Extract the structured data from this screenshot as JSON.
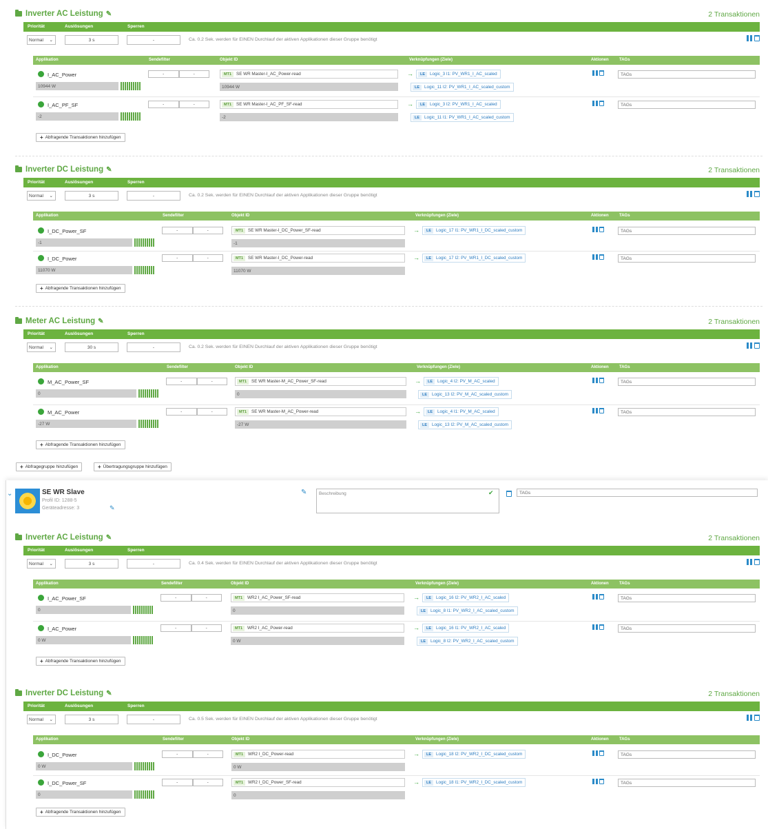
{
  "labels": {
    "prioritaet": "Priorität",
    "ausloesungen": "Auslösungen",
    "sperren": "Sperren",
    "applikation": "Applikation",
    "sendefilter": "Sendefilter",
    "objekt_id": "Objekt ID",
    "verknuepfungen": "Verknüpfungen (Ziele)",
    "aktionen": "Aktionen",
    "tags": "TAGs",
    "add_transactions": "Abfragende Transaktionen hinzufügen",
    "add_query_group": "Abfragegruppe hinzufügen",
    "add_transfer_group": "Übertragungsgruppe hinzufügen",
    "tags_placeholder": "TAGs",
    "dash": "-",
    "mt_badge": "MT1",
    "le_badge": "LE"
  },
  "groups": [
    {
      "title": "Inverter AC Leistung",
      "count": "2 Transaktionen",
      "priority": "Normal",
      "trigger": "3 s",
      "lock": "-",
      "note": "Ca. 0.2 Sek. werden für EINEN Durchlauf der aktiven Applikationen dieser Gruppe benötigt",
      "apps": [
        {
          "name": "I_AC_Power",
          "value": "10944 W",
          "object": "SE WR Master-I_AC_Power-read",
          "object_value": "10944 W",
          "links": [
            "Logic_3 I1: PV_WR1_I_AC_scaled",
            "Logic_11 I2: PV_WR1_I_AC_scaled_custom"
          ]
        },
        {
          "name": "I_AC_PF_SF",
          "value": "-2",
          "object": "SE WR Master-I_AC_PF_SF-read",
          "object_value": "-2",
          "links": [
            "Logic_3 I2: PV_WR1_I_AC_scaled",
            "Logic_11 I1: PV_WR1_I_AC_scaled_custom"
          ]
        }
      ]
    },
    {
      "title": "Inverter DC Leistung",
      "count": "2 Transaktionen",
      "priority": "Normal",
      "trigger": "3 s",
      "lock": "-",
      "note": "Ca. 0.2 Sek. werden für EINEN Durchlauf der aktiven Applikationen dieser Gruppe benötigt",
      "apps": [
        {
          "name": "I_DC_Power_SF",
          "value": "-1",
          "object": "SE WR Master-I_DC_Power_SF-read",
          "object_value": "-1",
          "links": [
            "Logic_17 I1: PV_WR1_I_DC_scaled_custom"
          ]
        },
        {
          "name": "I_DC_Power",
          "value": "11070 W",
          "object": "SE WR Master-I_DC_Power-read",
          "object_value": "11070 W",
          "links": [
            "Logic_17 I2: PV_WR1_I_DC_scaled_custom"
          ]
        }
      ]
    },
    {
      "title": "Meter AC Leistung",
      "count": "2 Transaktionen",
      "priority": "Normal",
      "trigger": "30 s",
      "lock": "-",
      "note": "Ca. 0.2 Sek. werden für EINEN Durchlauf der aktiven Applikationen dieser Gruppe benötigt",
      "apps": [
        {
          "name": "M_AC_Power_SF",
          "value": "0",
          "object": "SE WR Master-M_AC_Power_SF-read",
          "object_value": "0",
          "links": [
            "Logic_4 I2: PV_M_AC_scaled",
            "Logic_13 I2: PV_M_AC_scaled_custom"
          ]
        },
        {
          "name": "M_AC_Power",
          "value": "-27 W",
          "object": "SE WR Master-M_AC_Power-read",
          "object_value": "-27 W",
          "links": [
            "Logic_4 I1: PV_M_AC_scaled",
            "Logic_13 I2: PV_M_AC_scaled_custom"
          ]
        }
      ]
    },
    {
      "title": "Inverter AC Leistung",
      "count": "2 Transaktionen",
      "priority": "Normal",
      "trigger": "3 s",
      "lock": "-",
      "note": "Ca. 0.4 Sek. werden für EINEN Durchlauf der aktiven Applikationen dieser Gruppe benötigt",
      "apps": [
        {
          "name": "I_AC_Power_SF",
          "value": "0",
          "object": "WR2 I_AC_Power_SF-read",
          "object_value": "0",
          "links": [
            "Logic_16 I2: PV_WR2_I_AC_scaled",
            "Logic_8 I1: PV_WR2_I_AC_scaled_custom"
          ]
        },
        {
          "name": "I_AC_Power",
          "value": "0 W",
          "object": "WR2 I_AC_Power-read",
          "object_value": "0 W",
          "links": [
            "Logic_16 I1: PV_WR2_I_AC_scaled",
            "Logic_8 I2: PV_WR2_I_AC_scaled_custom"
          ]
        }
      ]
    },
    {
      "title": "Inverter DC Leistung",
      "count": "2 Transaktionen",
      "priority": "Normal",
      "trigger": "3 s",
      "lock": "-",
      "note": "Ca. 0.5 Sek. werden für EINEN Durchlauf der aktiven Applikationen dieser Gruppe benötigt",
      "apps": [
        {
          "name": "I_DC_Power",
          "value": "0 W",
          "object": "WR2 I_DC_Power-read",
          "object_value": "0 W",
          "links": [
            "Logic_18 I2: PV_WR2_I_DC_scaled_custom"
          ]
        },
        {
          "name": "I_DC_Power_SF",
          "value": "0",
          "object": "WR2 I_DC_Power_SF-read",
          "object_value": "0",
          "links": [
            "Logic_18 I1: PV_WR2_I_DC_scaled_custom"
          ]
        }
      ]
    }
  ],
  "device": {
    "name": "SE WR Slave",
    "profile": "Profil ID: 1288-5",
    "address": "Geräteadresse: 3",
    "description_placeholder": "Beschreibung",
    "tags_placeholder": "TAGs"
  },
  "colors": {
    "green": "#6cb33f",
    "light_green": "#8dc263",
    "blue": "#2a8ac8"
  }
}
